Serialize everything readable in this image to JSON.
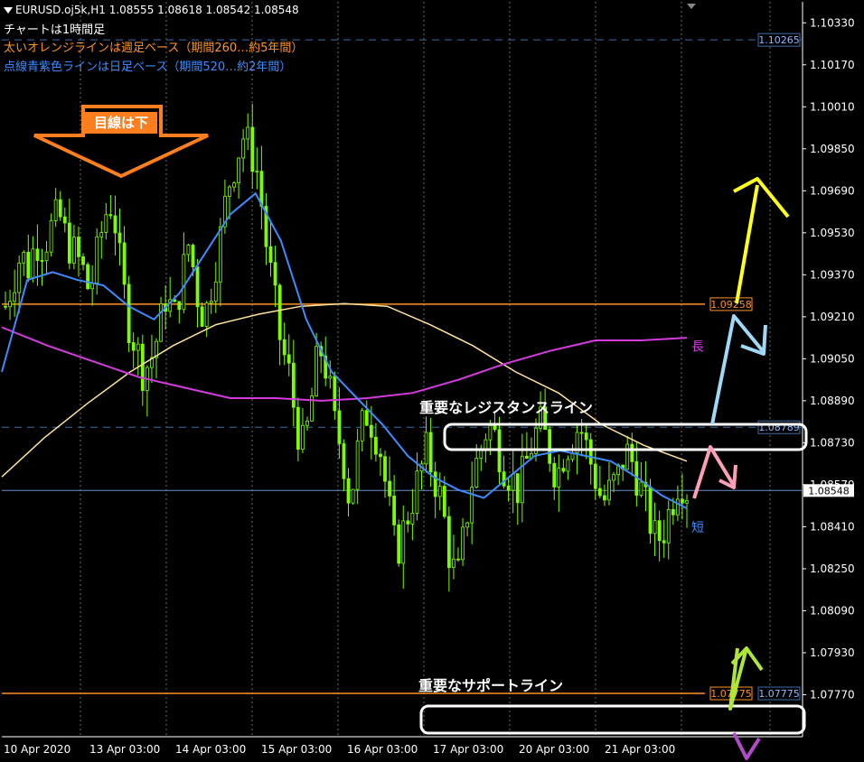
{
  "header": {
    "symbol_line": "EURUSD.oj5k,H1  1.08555 1.08618 1.08542 1.08548",
    "note_1": "チャートは1時間足",
    "note_2": "太いオレンジラインは週足ベース（期間260…約5年間）",
    "note_3": "点線青紫色ラインは日足ベース（期間520…約2年間）"
  },
  "colors": {
    "background": "#000000",
    "candle": "#7CFC00",
    "orange_line": "#ff9326",
    "blue_dashed": "#3d6ea8",
    "ma_short": "#3d8cff",
    "ma_long": "#d63be0",
    "ma_mid": "#ffe49a",
    "price_line": "#6b8fc7"
  },
  "annotations": {
    "arrow_label": "目線は下",
    "resistance_label": "重要なレジスタンスライン",
    "support_label": "重要なサポートライン",
    "long_label": "長",
    "short_label": "短"
  },
  "chart_data": {
    "type": "candlestick",
    "symbol": "EURUSD.oj5k",
    "timeframe": "H1",
    "ylim": [
      1.0761,
      1.1041
    ],
    "y_ticks": [
      "1.10330",
      "1.10170",
      "1.10010",
      "1.09850",
      "1.09690",
      "1.09530",
      "1.09370",
      "1.09210",
      "1.09050",
      "1.08890",
      "1.08730",
      "1.08570",
      "1.08410",
      "1.08250",
      "1.08090",
      "1.07930",
      "1.07770"
    ],
    "x_ticks": [
      "10 Apr 2020",
      "13 Apr 03:00",
      "14 Apr 03:00",
      "15 Apr 03:00",
      "16 Apr 03:00",
      "17 Apr 03:00",
      "20 Apr 03:00",
      "21 Apr 03:00"
    ],
    "horizontal_lines": [
      {
        "label": "1.10265",
        "value": 1.10265,
        "style": "dashed-blue"
      },
      {
        "label": "1.09258",
        "value": 1.09258,
        "style": "solid-orange"
      },
      {
        "label": "1.08789",
        "value": 1.08789,
        "style": "dashed-blue"
      },
      {
        "label": "1.08548",
        "value": 1.08548,
        "style": "price"
      },
      {
        "label": "1.07775",
        "value": 1.07775,
        "style": "solid-orange"
      },
      {
        "label": "1.07775",
        "value": 1.07775,
        "style": "dashed-blue"
      }
    ],
    "close_path": [
      1.0925,
      1.0935,
      1.0945,
      1.094,
      1.095,
      1.0948,
      1.0955,
      1.096,
      1.095,
      1.0945,
      1.094,
      1.093,
      1.0945,
      1.096,
      1.0965,
      1.094,
      1.092,
      1.091,
      1.09,
      1.0905,
      1.0915,
      1.093,
      1.092,
      1.0935,
      1.095,
      1.093,
      1.092,
      1.0935,
      1.095,
      1.097,
      1.098,
      1.099,
      1.0985,
      1.0975,
      1.095,
      1.093,
      1.091,
      1.09,
      1.088,
      1.087,
      1.089,
      1.091,
      1.09,
      1.088,
      1.087,
      1.085,
      1.087,
      1.0885,
      1.088,
      1.087,
      1.085,
      1.083,
      1.084,
      1.085,
      1.086,
      1.087,
      1.086,
      1.085,
      1.083,
      1.082,
      1.084,
      1.086,
      1.087,
      1.088,
      1.0875,
      1.0865,
      1.086,
      1.0855,
      1.0865,
      1.0875,
      1.088,
      1.087,
      1.086,
      1.087,
      1.0875,
      1.088,
      1.087,
      1.086,
      1.085,
      1.0855,
      1.086,
      1.087,
      1.0865,
      1.0855,
      1.0845,
      1.0835,
      1.084,
      1.085,
      1.086,
      1.0855
    ],
    "ma_short": [
      1.09,
      1.0935,
      1.0938,
      1.0935,
      1.0933,
      1.0925,
      1.092,
      1.093,
      1.0945,
      1.096,
      1.0968,
      1.095,
      1.092,
      1.09,
      1.089,
      1.088,
      1.0868,
      1.086,
      1.0855,
      1.0852,
      1.086,
      1.0868,
      1.087,
      1.0868,
      1.0866,
      1.086,
      1.0853,
      1.0848
    ],
    "ma_long": [
      1.0917,
      1.091,
      1.0904,
      1.0898,
      1.0894,
      1.089,
      1.089,
      1.0889,
      1.089,
      1.0892,
      1.0897,
      1.0903,
      1.0908,
      1.0912,
      1.0912,
      1.0913
    ],
    "ma_mid": [
      1.086,
      1.0875,
      1.0888,
      1.09,
      1.091,
      1.0918,
      1.0922,
      1.0925,
      1.0926,
      1.0925,
      1.0918,
      1.091,
      1.09,
      1.0892,
      1.088,
      1.0872,
      1.0866
    ]
  }
}
